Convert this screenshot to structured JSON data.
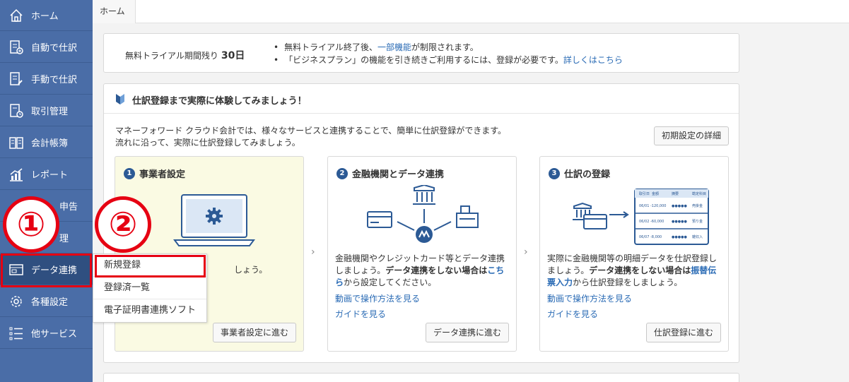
{
  "sidebar": {
    "items": [
      {
        "label": "ホーム",
        "icon": "home-icon"
      },
      {
        "label": "自動で仕訳",
        "icon": "auto-journal-icon"
      },
      {
        "label": "手動で仕訳",
        "icon": "manual-journal-icon"
      },
      {
        "label": "取引管理",
        "icon": "transaction-icon"
      },
      {
        "label": "会計帳簿",
        "icon": "ledger-icon"
      },
      {
        "label": "レポート",
        "icon": "report-icon"
      },
      {
        "label": "申告",
        "icon": "tax-icon"
      },
      {
        "label": "理",
        "icon": "manage-icon"
      },
      {
        "label": "データ連携",
        "icon": "data-link-icon"
      },
      {
        "label": "各種設定",
        "icon": "gear-icon"
      },
      {
        "label": "他サービス",
        "icon": "list-icon"
      }
    ]
  },
  "breadcrumb": {
    "home": "ホーム"
  },
  "trial": {
    "remain_label": "無料トライアル期間残り",
    "remain_days": "30日",
    "line1_a": "無料トライアル終了後、",
    "line1_link": "一部機能",
    "line1_b": "が制限されます。",
    "line2_a": "「ビジネスプラン」の機能を引き続きご利用するには、登録が必要です。",
    "line2_link": "詳しくはこちら"
  },
  "guide": {
    "title": "仕訳登録まで実際に体験してみましょう！",
    "intro1": "マネーフォワード クラウド会計では、様々なサービスと連携することで、簡単に仕訳登録ができます。",
    "intro2": "流れに沿って、実際に仕訳登録してみましょう。",
    "detail_button": "初期設定の詳細",
    "steps": [
      {
        "num": "1",
        "title": "事業者設定",
        "desc_tail": "しょう。",
        "button": "事業者設定に進む"
      },
      {
        "num": "2",
        "title": "金融機関とデータ連携",
        "desc_a": "金融機関やクレジットカード等とデータ連携しましょう。",
        "desc_b": "データ連携をしない場合は",
        "desc_link": "こちら",
        "desc_c": "から設定してください。",
        "link1": "動画で操作方法を見る",
        "link2": "ガイドを見る",
        "button": "データ連携に進む"
      },
      {
        "num": "3",
        "title": "仕訳の登録",
        "desc_a": "実際に金融機関等の明細データを仕訳登録しましょう。",
        "desc_b": "データ連携をしない場合は",
        "desc_link": "振替伝票入力",
        "desc_c": "から仕訳登録をしましょう。",
        "link1": "動画で操作方法を見る",
        "link2": "ガイドを見る",
        "button": "仕訳登録に進む"
      }
    ]
  },
  "popup": {
    "items": [
      "新規登録",
      "登録済一覧",
      "電子証明書連携ソフト"
    ]
  },
  "annotations": {
    "one": "①",
    "two": "②",
    "color": "#e60012"
  }
}
